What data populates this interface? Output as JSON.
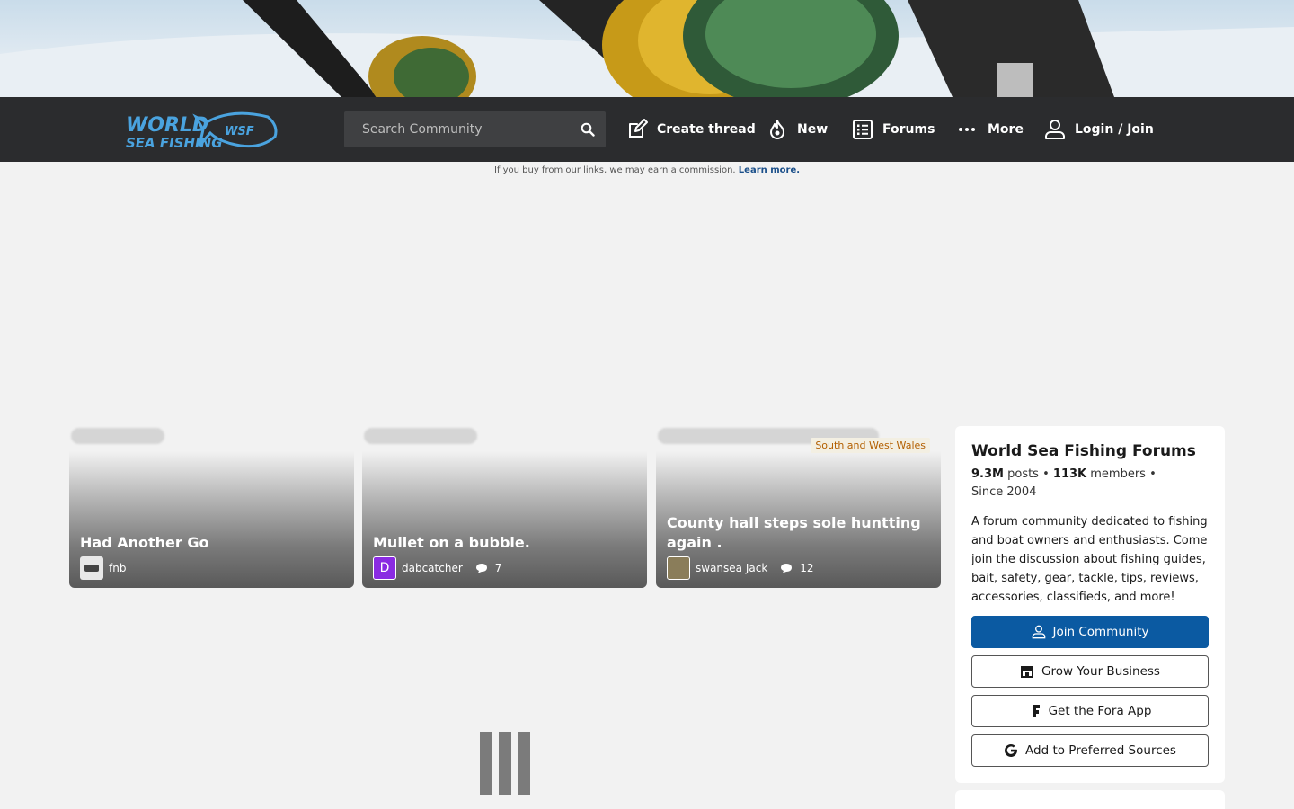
{
  "header": {
    "logo_alt": "World Sea Fishing",
    "search_placeholder": "Search Community",
    "nav": {
      "create_thread": "Create thread",
      "new": "New",
      "forums": "Forums",
      "more": "More",
      "login": "Login / Join"
    }
  },
  "commission": {
    "text": "If you buy from our links, we may earn a commission.",
    "link": "Learn more."
  },
  "cards": [
    {
      "title": "Had Another Go",
      "author": "fnb",
      "comments": "",
      "region": ""
    },
    {
      "title": "Mullet on a bubble.",
      "author": "dabcatcher",
      "avatar_letter": "D",
      "comments": "7",
      "region": ""
    },
    {
      "title": "County hall steps sole huntting again .",
      "author": "swansea Jack",
      "comments": "12",
      "region": "South and West Wales"
    }
  ],
  "sidebar": {
    "title": "World Sea Fishing Forums",
    "posts_value": "9.3M",
    "posts_label": "posts",
    "members_value": "113K",
    "members_label": "members",
    "since": "Since 2004",
    "description": "A forum community dedicated to fishing and boat owners and enthusiasts. Come join the discussion about fishing guides, bait, safety, gear, tackle, tips, reviews, accessories, classifieds, and more!",
    "buttons": {
      "join": "Join Community",
      "grow": "Grow Your Business",
      "app": "Get the Fora App",
      "sources": "Add to Preferred Sources"
    }
  },
  "colors": {
    "navbar": "#2b2c2e",
    "primary_button": "#0b5aa2",
    "logo_blue": "#4aa3df",
    "region_text": "#b35f00"
  }
}
